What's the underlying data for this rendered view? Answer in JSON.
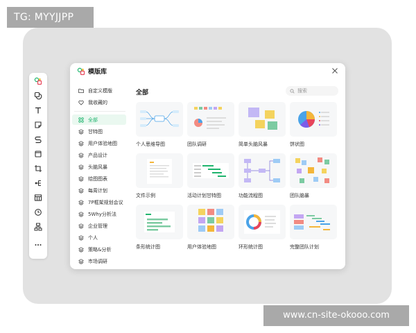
{
  "watermark_top": "TG: MYYJJPP",
  "watermark_bottom": "www.cn-site-okooo.com",
  "toolbar": {
    "tools": [
      {
        "icon": "template-icon",
        "name": "tool-template"
      },
      {
        "icon": "shape-icon",
        "name": "tool-shape"
      },
      {
        "icon": "text-icon",
        "name": "tool-text"
      },
      {
        "icon": "sticky-note-icon",
        "name": "tool-sticky-note"
      },
      {
        "icon": "connector-icon",
        "name": "tool-connector"
      },
      {
        "icon": "frame-icon",
        "name": "tool-frame"
      },
      {
        "icon": "crop-icon",
        "name": "tool-crop"
      },
      {
        "icon": "mindmap-icon",
        "name": "tool-mindmap"
      },
      {
        "icon": "table-icon",
        "name": "tool-table"
      },
      {
        "icon": "clock-icon",
        "name": "tool-timer"
      },
      {
        "icon": "org-chart-icon",
        "name": "tool-org-chart"
      },
      {
        "icon": "more-icon",
        "name": "tool-more"
      }
    ]
  },
  "dialog": {
    "title": "模版库",
    "content_title": "全部",
    "search_placeholder": "搜索",
    "sidebar": {
      "top": [
        {
          "label": "自定义模版",
          "icon": "folder-icon"
        },
        {
          "label": "我收藏的",
          "icon": "heart-icon"
        }
      ],
      "categories": [
        {
          "label": "全部",
          "icon": "grid-icon",
          "active": true
        },
        {
          "label": "甘特图",
          "icon": "layers-icon"
        },
        {
          "label": "用户体验地图",
          "icon": "layers-icon"
        },
        {
          "label": "产品设计",
          "icon": "layers-icon"
        },
        {
          "label": "头脑风暴",
          "icon": "layers-icon"
        },
        {
          "label": "绘图图表",
          "icon": "layers-icon"
        },
        {
          "label": "每周计划",
          "icon": "layers-icon"
        },
        {
          "label": "7P框架规划会议",
          "icon": "layers-icon"
        },
        {
          "label": "5Why分析法",
          "icon": "layers-icon"
        },
        {
          "label": "企业管理",
          "icon": "layers-icon"
        },
        {
          "label": "个人",
          "icon": "layers-icon"
        },
        {
          "label": "策略&分析",
          "icon": "layers-icon"
        },
        {
          "label": "市场调研",
          "icon": "layers-icon"
        }
      ]
    },
    "templates": [
      {
        "label": "个人思维导图",
        "thumb": "mindmap"
      },
      {
        "label": "团队调研",
        "thumb": "survey"
      },
      {
        "label": "简单头脑风暴",
        "thumb": "sticky"
      },
      {
        "label": "饼状图",
        "thumb": "pie"
      },
      {
        "label": "文件示例",
        "thumb": "document"
      },
      {
        "label": "活动计划甘特图",
        "thumb": "gantt"
      },
      {
        "label": "功能流程图",
        "thumb": "flow"
      },
      {
        "label": "团队脑暴",
        "thumb": "team-brainstorm"
      },
      {
        "label": "条形统计图",
        "thumb": "bars"
      },
      {
        "label": "用户体验地图",
        "thumb": "journey"
      },
      {
        "label": "环形统计图",
        "thumb": "donut"
      },
      {
        "label": "完整团队计划",
        "thumb": "team-plan"
      }
    ]
  },
  "colors": {
    "accent": "#1fb46e",
    "device_frame": "#e2e2e2",
    "watermark_bg": "#a9a9a9"
  }
}
